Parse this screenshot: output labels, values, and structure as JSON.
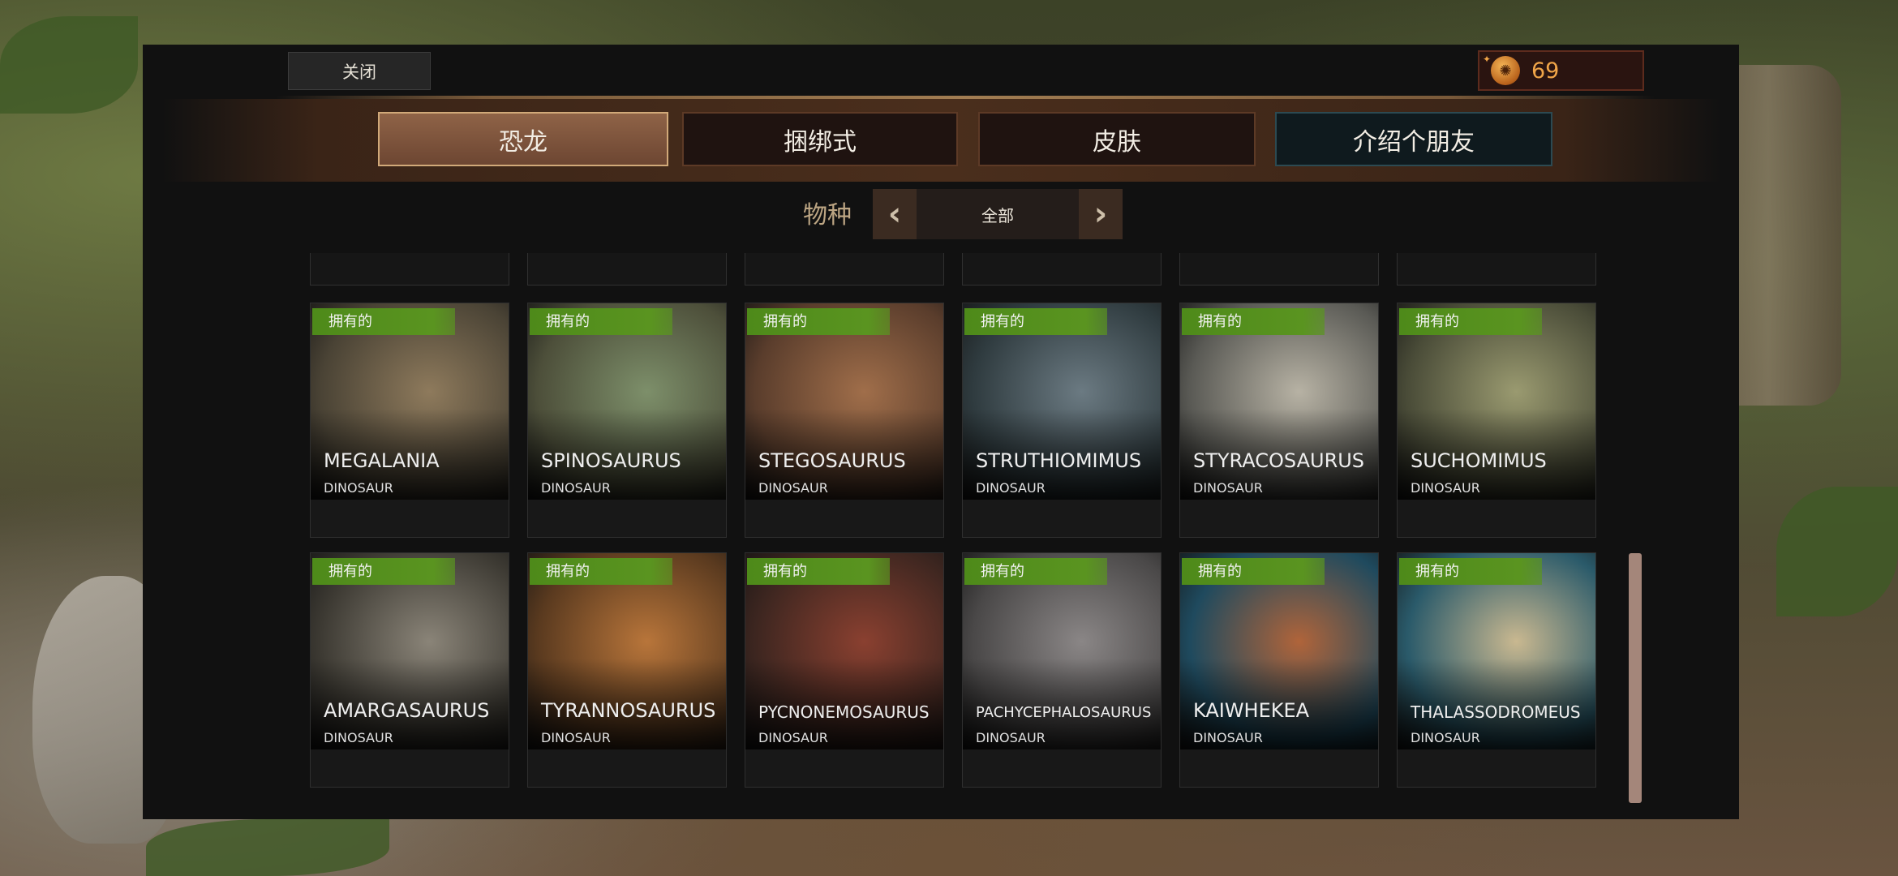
{
  "header": {
    "close_label": "关闭",
    "currency_amount": "69",
    "currency_icon": "dino-coin-icon"
  },
  "tabs": [
    {
      "label": "恐龙",
      "active": true
    },
    {
      "label": "捆绑式",
      "active": false
    },
    {
      "label": "皮肤",
      "active": false
    },
    {
      "label": "介绍个朋友",
      "active": false
    }
  ],
  "filter": {
    "label": "物种",
    "value": "全部",
    "prev_icon": "chevron-left-icon",
    "next_icon": "chevron-right-icon"
  },
  "cards": [
    {
      "owned_label": "拥有的",
      "name": "MEGALANIA",
      "type": "DINOSAUR",
      "colors": [
        "#4a4335",
        "#8e7a5c"
      ]
    },
    {
      "owned_label": "拥有的",
      "name": "SPINOSAURUS",
      "type": "DINOSAUR",
      "colors": [
        "#4d4f3a",
        "#7d8f6a"
      ]
    },
    {
      "owned_label": "拥有的",
      "name": "STEGOSAURUS",
      "type": "DINOSAUR",
      "colors": [
        "#5a3d2c",
        "#a06e4a"
      ]
    },
    {
      "owned_label": "拥有的",
      "name": "STRUTHIOMIMUS",
      "type": "DINOSAUR",
      "colors": [
        "#2f3b3f",
        "#6b7a82"
      ]
    },
    {
      "owned_label": "拥有的",
      "name": "STYRACOSAURUS",
      "type": "DINOSAUR",
      "colors": [
        "#5a5a55",
        "#b7b2a4"
      ]
    },
    {
      "owned_label": "拥有的",
      "name": "SUCHOMIMUS",
      "type": "DINOSAUR",
      "colors": [
        "#4a4c38",
        "#9a9a70"
      ]
    },
    {
      "owned_label": "拥有的",
      "name": "AMARGASAURUS",
      "type": "DINOSAUR",
      "colors": [
        "#3d3a33",
        "#8a8478"
      ]
    },
    {
      "owned_label": "拥有的",
      "name": "TYRANNOSAURUS",
      "type": "DINOSAUR",
      "colors": [
        "#5a3a1f",
        "#b8753a"
      ]
    },
    {
      "owned_label": "拥有的",
      "name": "PYCNONEMOSAURUS",
      "type": "DINOSAUR",
      "colors": [
        "#3d2620",
        "#8a4030"
      ]
    },
    {
      "owned_label": "拥有的",
      "name": "PACHYCEPHALOSAURUS",
      "type": "DINOSAUR",
      "colors": [
        "#4a4848",
        "#8a8686"
      ]
    },
    {
      "owned_label": "拥有的",
      "name": "KAIWHEKEA",
      "type": "DINOSAUR",
      "colors": [
        "#1f4a5e",
        "#b0643a"
      ]
    },
    {
      "owned_label": "拥有的",
      "name": "THALASSODROMEUS",
      "type": "DINOSAUR",
      "colors": [
        "#2a5a6a",
        "#c9b890"
      ]
    }
  ]
}
